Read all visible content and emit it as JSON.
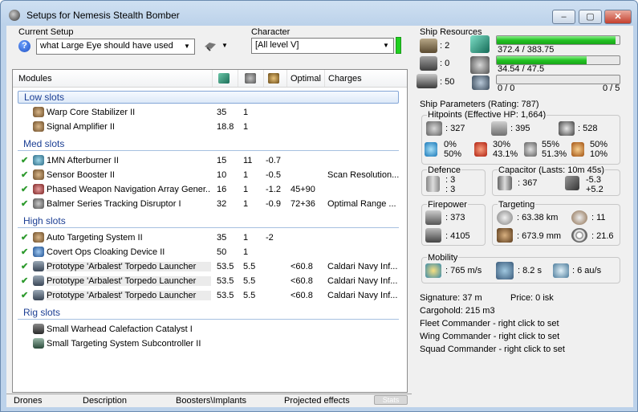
{
  "window": {
    "title": "Setups for Nemesis Stealth Bomber",
    "minimize": "–",
    "maximize": "▢",
    "close": "✕"
  },
  "setup": {
    "label": "Current Setup",
    "value": "what Large Eye should have used"
  },
  "character": {
    "label": "Character",
    "value": "[All level V]"
  },
  "columns": {
    "modules": "Modules",
    "optimal": "Optimal",
    "charges": "Charges"
  },
  "sections": {
    "low": "Low slots",
    "med": "Med slots",
    "high": "High slots",
    "rig": "Rig slots"
  },
  "low_slots": [
    {
      "name": "Warp Core Stabilizer II",
      "c1": "35",
      "c2": "1",
      "c3": "",
      "c4": "",
      "c5": ""
    },
    {
      "name": "Signal Amplifier II",
      "c1": "18.8",
      "c2": "1",
      "c3": "",
      "c4": "",
      "c5": ""
    }
  ],
  "med_slots": [
    {
      "name": "1MN Afterburner II",
      "c1": "15",
      "c2": "11",
      "c3": "-0.7",
      "c4": "",
      "c5": ""
    },
    {
      "name": "Sensor Booster II",
      "c1": "10",
      "c2": "1",
      "c3": "-0.5",
      "c4": "",
      "c5": "Scan Resolution..."
    },
    {
      "name": "Phased Weapon Navigation Array Gener...",
      "c1": "16",
      "c2": "1",
      "c3": "-1.2",
      "c4": "45+90",
      "c5": ""
    },
    {
      "name": "Balmer Series Tracking Disruptor I",
      "c1": "32",
      "c2": "1",
      "c3": "-0.9",
      "c4": "72+36",
      "c5": "Optimal Range ..."
    }
  ],
  "high_slots": [
    {
      "name": "Auto Targeting System II",
      "c1": "35",
      "c2": "1",
      "c3": "-2",
      "c4": "",
      "c5": ""
    },
    {
      "name": "Covert Ops Cloaking Device II",
      "c1": "50",
      "c2": "1",
      "c3": "",
      "c4": "",
      "c5": ""
    },
    {
      "name": "Prototype 'Arbalest' Torpedo Launcher",
      "c1": "53.5",
      "c2": "5.5",
      "c3": "",
      "c4": "<60.8",
      "c5": "Caldari Navy Inf..."
    },
    {
      "name": "Prototype 'Arbalest' Torpedo Launcher",
      "c1": "53.5",
      "c2": "5.5",
      "c3": "",
      "c4": "<60.8",
      "c5": "Caldari Navy Inf..."
    },
    {
      "name": "Prototype 'Arbalest' Torpedo Launcher",
      "c1": "53.5",
      "c2": "5.5",
      "c3": "",
      "c4": "<60.8",
      "c5": "Caldari Navy Inf..."
    }
  ],
  "rig_slots": [
    {
      "name": "Small Warhead Calefaction Catalyst I"
    },
    {
      "name": "Small Targeting System Subcontroller II"
    }
  ],
  "bottom_tabs": {
    "drones": "Drones",
    "description": "Description",
    "boosters": "Boosters\\Implants",
    "projected": "Projected effects",
    "stats": "Stats"
  },
  "resources": {
    "title": "Ship Resources",
    "turrets": ": 2",
    "launchers": ": 0",
    "calibration": ": 50",
    "cpu_text": "372.4 / 383.75",
    "cpu_fraction": 0.97,
    "pg_text": "34.54 / 47.5",
    "pg_fraction": 0.73,
    "drone_text": "0 / 0",
    "drone_fraction": 0,
    "drone_bw_text": "0 / 5"
  },
  "params": {
    "title": "Ship Parameters (Rating: 787)",
    "hitpoints_title": "Hitpoints (Effective HP: 1,664)",
    "shield_hp": ": 327",
    "armor_hp": ": 395",
    "structure_hp": ": 528",
    "res_em_1": "0%",
    "res_em_2": "50%",
    "res_th_1": "30%",
    "res_th_2": "43.1%",
    "res_ki_1": "55%",
    "res_ki_2": "51.3%",
    "res_ex_1": "50%",
    "res_ex_2": "10%",
    "defence_title": "Defence",
    "defence_1": ": 3",
    "defence_2": ": 3",
    "capacitor_title": "Capacitor (Lasts: 10m 45s)",
    "cap_amount": ": 367",
    "cap_delta_1": "-5.3",
    "cap_delta_2": "+5.2",
    "firepower_title": "Firepower",
    "firepower_1": ": 373",
    "firepower_2": ": 4105",
    "targeting_title": "Targeting",
    "target_range": ": 63.38 km",
    "max_targets": ": 11",
    "scan_res": ": 673.9 mm",
    "sensor_str": ": 21.6",
    "mobility_title": "Mobility",
    "speed": ": 765 m/s",
    "align": ": 8.2 s",
    "warp": ": 6 au/s"
  },
  "info": {
    "signature": "Signature: 37 m",
    "price": "Price: 0 isk",
    "cargohold": "Cargohold: 215 m3",
    "fleet": "Fleet Commander - right click to set",
    "wing": "Wing Commander - right click to set",
    "squad": "Squad Commander - right click to set"
  },
  "colors": {
    "section_text": "#1c3f94",
    "check": "#2d9a2d",
    "bar_fill": "#23c323",
    "character_indicator": "#20d020"
  }
}
